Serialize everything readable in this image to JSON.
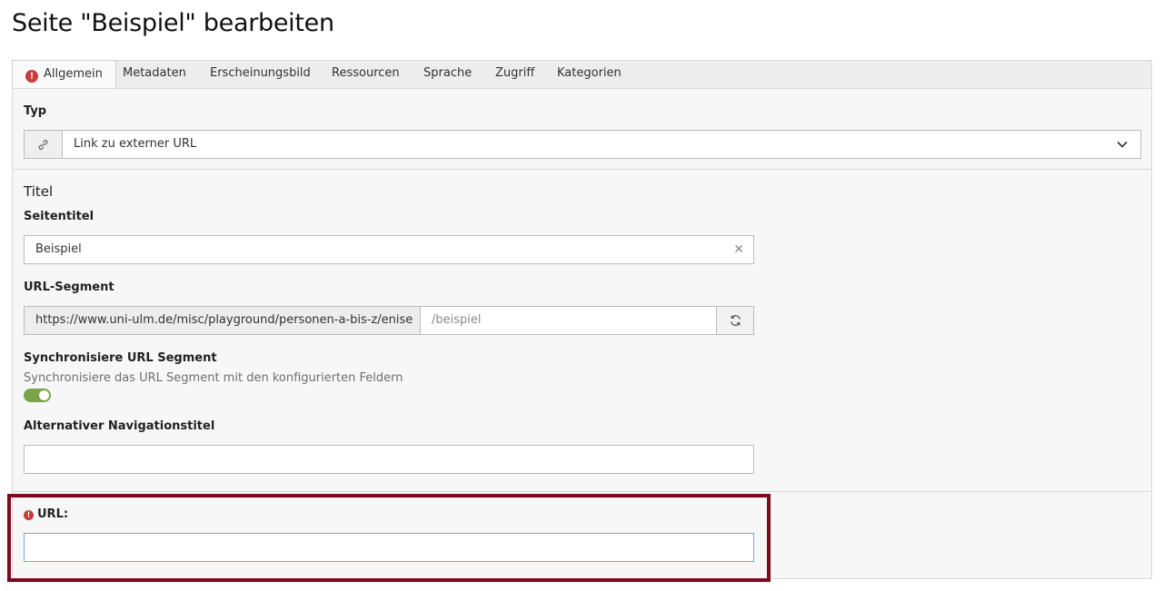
{
  "page_title": "Seite \"Beispiel\" bearbeiten",
  "tabs": [
    {
      "label": "Allgemein",
      "active": true,
      "has_error": true
    },
    {
      "label": "Metadaten"
    },
    {
      "label": "Erscheinungsbild"
    },
    {
      "label": "Ressourcen"
    },
    {
      "label": "Sprache"
    },
    {
      "label": "Zugriff"
    },
    {
      "label": "Kategorien"
    }
  ],
  "type_field": {
    "label": "Typ",
    "value": "Link zu externer URL",
    "icon": "link-icon"
  },
  "title_section": {
    "heading": "Titel",
    "page_title_label": "Seitentitel",
    "page_title_value": "Beispiel",
    "url_segment_label": "URL-Segment",
    "url_prefix": "https://www.uni-ulm.de/misc/playground/personen-a-bis-z/enise",
    "url_segment_value": "/beispiel",
    "sync_label": "Synchronisiere URL Segment",
    "sync_description": "Synchronisiere das URL Segment mit den konfigurierten Feldern",
    "sync_enabled": true,
    "nav_title_label": "Alternativer Navigationstitel",
    "nav_title_value": ""
  },
  "url_field": {
    "label": "URL:",
    "value": "",
    "has_error": true
  },
  "colors": {
    "accent_error": "#c83c3c",
    "toggle_on": "#79a548",
    "highlight": "#7b0a21",
    "focus_border": "#6daae0"
  }
}
